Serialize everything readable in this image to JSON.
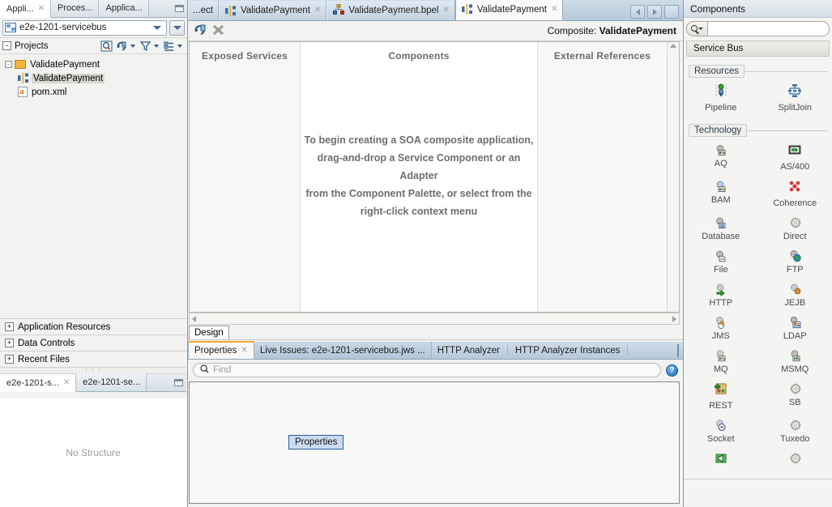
{
  "left_panel": {
    "dock_tabs": [
      {
        "label": "Appli...",
        "closable": true,
        "active": true
      },
      {
        "label": "Proces...",
        "closable": false,
        "active": false
      },
      {
        "label": "Applica...",
        "closable": false,
        "active": false
      }
    ],
    "minimize_title": "Minimize",
    "application_combo": {
      "value": "e2e-1201-servicebus",
      "icon": "application-icon",
      "dropdown_icon": "chevron-down-icon",
      "menu_button_icon": "chevron-down-icon"
    },
    "projects_header": {
      "label": "Projects",
      "expander": "-",
      "tools": [
        "search-project-icon",
        "refresh-icon",
        "filter-icon",
        "view-options-icon"
      ]
    },
    "tree": [
      {
        "label": "ValidatePayment",
        "icon": "folder-icon",
        "expander": "-",
        "depth": 0,
        "selected": false
      },
      {
        "label": "ValidatePayment",
        "icon": "soa-composite-icon",
        "expander": "",
        "depth": 1,
        "selected": true
      },
      {
        "label": "pom.xml",
        "icon": "xml-file-icon",
        "expander": "",
        "depth": 1,
        "selected": false
      }
    ],
    "accordions": [
      {
        "label": "Application Resources",
        "expander": "+"
      },
      {
        "label": "Data Controls",
        "expander": "+"
      },
      {
        "label": "Recent Files",
        "expander": "+"
      }
    ],
    "structure_tabs": [
      {
        "label": "e2e-1201-s...",
        "closable": true,
        "active": true
      },
      {
        "label": "e2e-1201-se...",
        "closable": false,
        "active": false
      }
    ],
    "structure_empty_text": "No Structure"
  },
  "editor": {
    "tabs": [
      {
        "label": "...ect",
        "icon": "",
        "closable": false,
        "active": false
      },
      {
        "label": "ValidatePayment",
        "icon": "soa-composite-icon",
        "closable": true,
        "active": false
      },
      {
        "label": "ValidatePayment.bpel",
        "icon": "bpel-icon",
        "closable": true,
        "active": false
      },
      {
        "label": "ValidatePayment",
        "icon": "soa-composite-icon",
        "closable": true,
        "active": true
      }
    ],
    "nav_buttons": [
      "back-icon",
      "forward-icon",
      "tab-list-icon"
    ],
    "toolbar": {
      "icons": [
        "refresh-icon",
        "delete-icon"
      ],
      "composite_prefix": "Composite: ",
      "composite_name": "ValidatePayment"
    },
    "canvas": {
      "lanes": [
        {
          "title": "Exposed Services"
        },
        {
          "title": "Components"
        },
        {
          "title": "External References"
        }
      ],
      "hint_lines": [
        "To begin creating a SOA composite application,",
        "drag-and-drop a Service Component or an Adapter",
        "from the Component Palette, or select from the",
        "right-click context menu"
      ]
    },
    "design_tabs": [
      {
        "label": "Design",
        "active": true
      }
    ]
  },
  "properties_panel": {
    "tabs": [
      {
        "label": "Properties",
        "closable": true,
        "active": true
      },
      {
        "label": "Live Issues: e2e-1201-servicebus.jws ...",
        "closable": false,
        "active": false
      },
      {
        "label": "HTTP Analyzer",
        "closable": false,
        "active": false
      },
      {
        "label": "HTTP Analyzer Instances",
        "closable": false,
        "active": false
      }
    ],
    "minimize_icon": "minimize-icon",
    "find": {
      "placeholder": "Find",
      "value": "",
      "icon": "search-icon"
    },
    "help_icon": "help-icon",
    "body_chip": "Properties"
  },
  "palette": {
    "title": "Components",
    "search": {
      "placeholder": "",
      "value": "",
      "icon": "search-icon",
      "dropdown_icon": "chevron-down-icon"
    },
    "group": "Service Bus",
    "sections": [
      {
        "label": "Resources",
        "items": [
          {
            "label": "Pipeline",
            "icon": "pipeline-icon"
          },
          {
            "label": "SplitJoin",
            "icon": "splitjoin-icon"
          }
        ]
      },
      {
        "label": "Technology",
        "items": [
          {
            "label": "AQ",
            "icon": "aq-adapter-icon"
          },
          {
            "label": "AS/400",
            "icon": "as400-adapter-icon"
          },
          {
            "label": "BAM",
            "icon": "bam-adapter-icon"
          },
          {
            "label": "Coherence",
            "icon": "coherence-adapter-icon"
          },
          {
            "label": "Database",
            "icon": "database-adapter-icon"
          },
          {
            "label": "Direct",
            "icon": "direct-adapter-icon"
          },
          {
            "label": "File",
            "icon": "file-adapter-icon"
          },
          {
            "label": "FTP",
            "icon": "ftp-adapter-icon"
          },
          {
            "label": "HTTP",
            "icon": "http-adapter-icon"
          },
          {
            "label": "JEJB",
            "icon": "jejb-adapter-icon"
          },
          {
            "label": "JMS",
            "icon": "jms-adapter-icon"
          },
          {
            "label": "LDAP",
            "icon": "ldap-adapter-icon"
          },
          {
            "label": "MQ",
            "icon": "mq-adapter-icon"
          },
          {
            "label": "MSMQ",
            "icon": "msmq-adapter-icon"
          },
          {
            "label": "REST",
            "icon": "rest-adapter-icon"
          },
          {
            "label": "SB",
            "icon": "sb-adapter-icon"
          },
          {
            "label": "Socket",
            "icon": "socket-adapter-icon"
          },
          {
            "label": "Tuxedo",
            "icon": "tuxedo-adapter-icon"
          },
          {
            "label": "",
            "icon": "umt-adapter-icon"
          },
          {
            "label": "",
            "icon": "generic-adapter-icon"
          }
        ]
      }
    ]
  },
  "colors": {
    "accent_blue": "#2b5f9e",
    "tab_active_orange": "#f0a830",
    "chrome_blue": "#b7c9da",
    "panel_bg": "#f2f2f0"
  }
}
